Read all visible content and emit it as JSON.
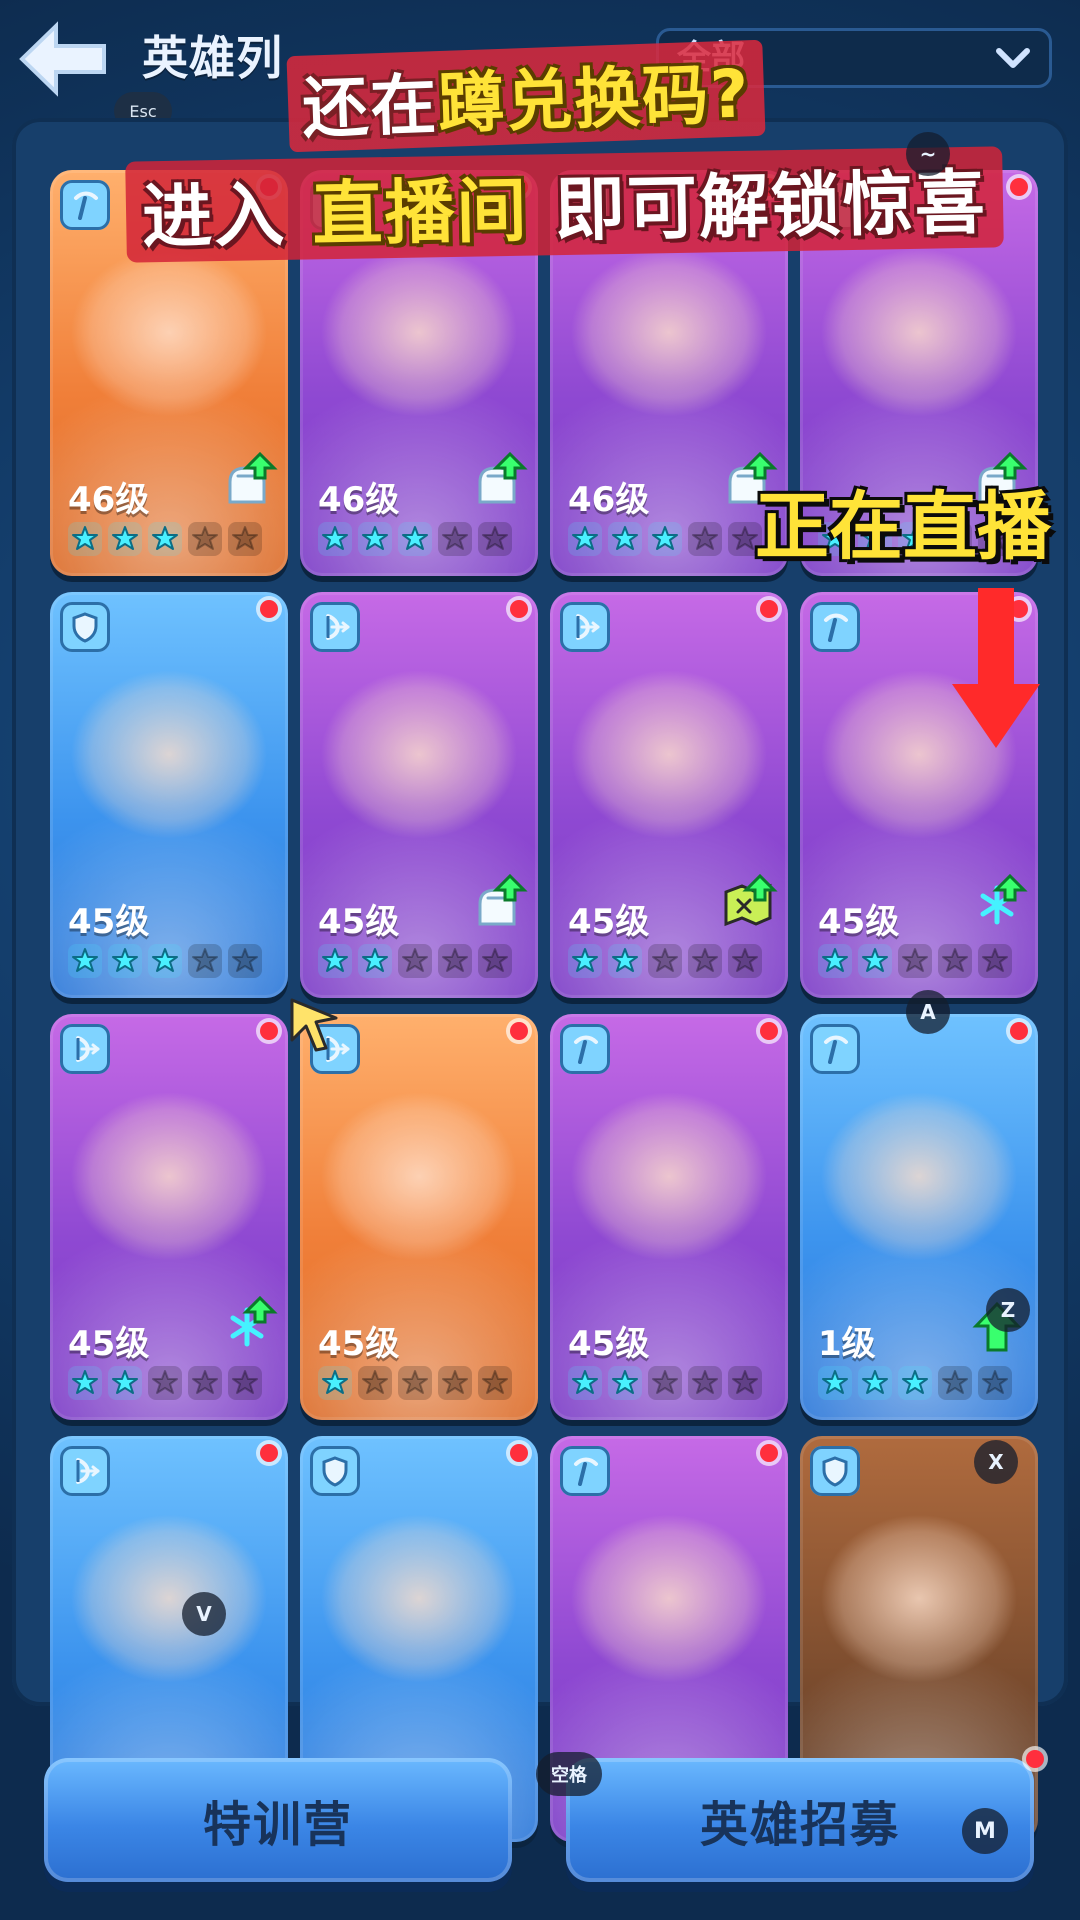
{
  "topbar": {
    "title": "英雄列",
    "esc_hint": "Esc",
    "filter_label": "全部",
    "chevron_icon": "chevron-down-icon"
  },
  "overlay": {
    "promo_line1_a": "还在",
    "promo_line1_b": "蹲",
    "promo_line1_c": "兑换码",
    "promo_line1_d": "?",
    "promo_line2_a": "进入",
    "promo_line2_b": "直播间",
    "promo_line2_c": "即可解",
    "promo_line2_d": "锁惊喜",
    "live": "正在直播",
    "arrow_color": "#ff2a2a"
  },
  "grid": {
    "cards": [
      {
        "level": "46级",
        "bg": "orange",
        "class_icon": "pickaxe-icon",
        "stars": 3,
        "upgrade": "armor-up-icon",
        "dot": true
      },
      {
        "level": "46级",
        "bg": "purple",
        "class_icon": "pickaxe-icon",
        "stars": 3,
        "upgrade": "armor-up-icon",
        "dot": true
      },
      {
        "level": "46级",
        "bg": "purple",
        "class_icon": "pickaxe-icon",
        "stars": 3,
        "upgrade": "armor-up-icon",
        "dot": true
      },
      {
        "level": "",
        "bg": "purple",
        "class_icon": "pickaxe-icon",
        "stars": 3,
        "upgrade": "armor-up-icon",
        "dot": true
      },
      {
        "level": "45级",
        "bg": "blue",
        "class_icon": "shield-icon",
        "stars": 3,
        "upgrade": "",
        "dot": true
      },
      {
        "level": "45级",
        "bg": "purple",
        "class_icon": "bow-icon",
        "stars": 2,
        "upgrade": "armor-up-icon",
        "dot": true
      },
      {
        "level": "45级",
        "bg": "purple",
        "class_icon": "bow-icon",
        "stars": 2,
        "upgrade": "map-up-icon",
        "dot": true
      },
      {
        "level": "45级",
        "bg": "purple",
        "class_icon": "pickaxe-icon",
        "stars": 2,
        "upgrade": "snowflake-up-icon",
        "dot": true
      },
      {
        "level": "45级",
        "bg": "purple",
        "class_icon": "bow-icon",
        "stars": 2,
        "upgrade": "snowflake-up-icon",
        "dot": true
      },
      {
        "level": "45级",
        "bg": "orange",
        "class_icon": "bow-icon",
        "stars": 1,
        "upgrade": "",
        "dot": true
      },
      {
        "level": "45级",
        "bg": "purple",
        "class_icon": "pickaxe-icon",
        "stars": 2,
        "upgrade": "",
        "dot": true
      },
      {
        "level": "1级",
        "bg": "blue",
        "class_icon": "pickaxe-icon",
        "stars": 3,
        "upgrade": "arrow-up-icon",
        "dot": true
      },
      {
        "level": "",
        "bg": "blue",
        "class_icon": "bow-icon",
        "stars": 0,
        "upgrade": "",
        "dot": true
      },
      {
        "level": "",
        "bg": "blue",
        "class_icon": "shield-icon",
        "stars": 0,
        "upgrade": "",
        "dot": true
      },
      {
        "level": "",
        "bg": "purple",
        "class_icon": "pickaxe-icon",
        "stars": 0,
        "upgrade": "",
        "dot": true
      },
      {
        "level": "",
        "bg": "brown",
        "class_icon": "shield-icon",
        "stars": 0,
        "upgrade": "",
        "dot": false
      }
    ],
    "key_hints": {
      "a": "A",
      "z": "Z",
      "v": "V",
      "x": "X",
      "tilde": "~"
    }
  },
  "bottom": {
    "left_label": "特训营",
    "right_label": "英雄招募",
    "space_hint": "空格",
    "m_hint": "M"
  }
}
